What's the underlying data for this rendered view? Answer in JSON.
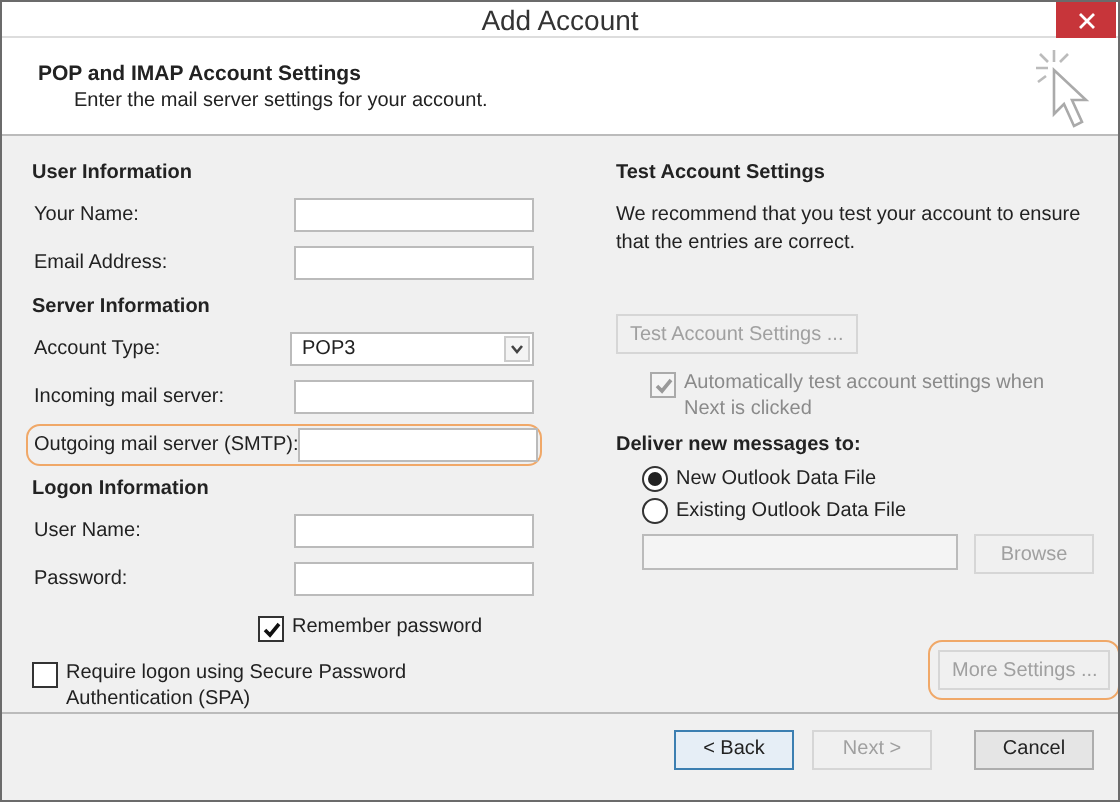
{
  "window": {
    "title": "Add Account"
  },
  "header": {
    "title": "POP and IMAP Account Settings",
    "subtitle": "Enter the mail server settings for your account."
  },
  "left": {
    "sections": [
      {
        "heading": "User Information",
        "fields": [
          {
            "label": "Your Name:",
            "kind": "text",
            "highlighted": false
          },
          {
            "label": "Email Address:",
            "kind": "text",
            "highlighted": false
          }
        ]
      },
      {
        "heading": "Server Information",
        "fields": [
          {
            "label": "Account Type:",
            "kind": "dropdown",
            "value": "POP3",
            "highlighted": false
          },
          {
            "label": "Incoming mail server:",
            "kind": "text",
            "highlighted": false
          },
          {
            "label": "Outgoing mail server (SMTP):",
            "kind": "text",
            "highlighted": true
          }
        ]
      },
      {
        "heading": "Logon Information",
        "fields": [
          {
            "label": "User Name:",
            "kind": "text",
            "highlighted": false
          },
          {
            "label": "Password:",
            "kind": "text",
            "highlighted": false
          }
        ]
      }
    ],
    "remember": {
      "label": "Remember password",
      "checked": true
    },
    "spa": {
      "label": "Require logon using Secure Password Authentication (SPA)",
      "checked": false
    }
  },
  "right": {
    "heading": "Test Account Settings",
    "description": "We recommend that you test your account to ensure that the entries are correct.",
    "test_button": {
      "label": "Test Account Settings ...",
      "disabled": true
    },
    "auto_test": {
      "label": "Automatically test account settings when Next is clicked",
      "checked": true,
      "disabled": true
    },
    "deliver_heading": "Deliver new messages to:",
    "radios": [
      {
        "label": "New Outlook Data File",
        "selected": true
      },
      {
        "label": "Existing Outlook Data File",
        "selected": false
      }
    ],
    "browse_button": {
      "label": "Browse",
      "disabled": true
    },
    "more_settings": {
      "label": "More Settings ...",
      "disabled": true,
      "highlighted": true
    }
  },
  "footer": {
    "buttons": [
      {
        "label": "< Back",
        "disabled": false,
        "default": true
      },
      {
        "label": "Next >",
        "disabled": true,
        "default": false
      },
      {
        "label": "Cancel",
        "disabled": false,
        "default": false
      }
    ]
  }
}
